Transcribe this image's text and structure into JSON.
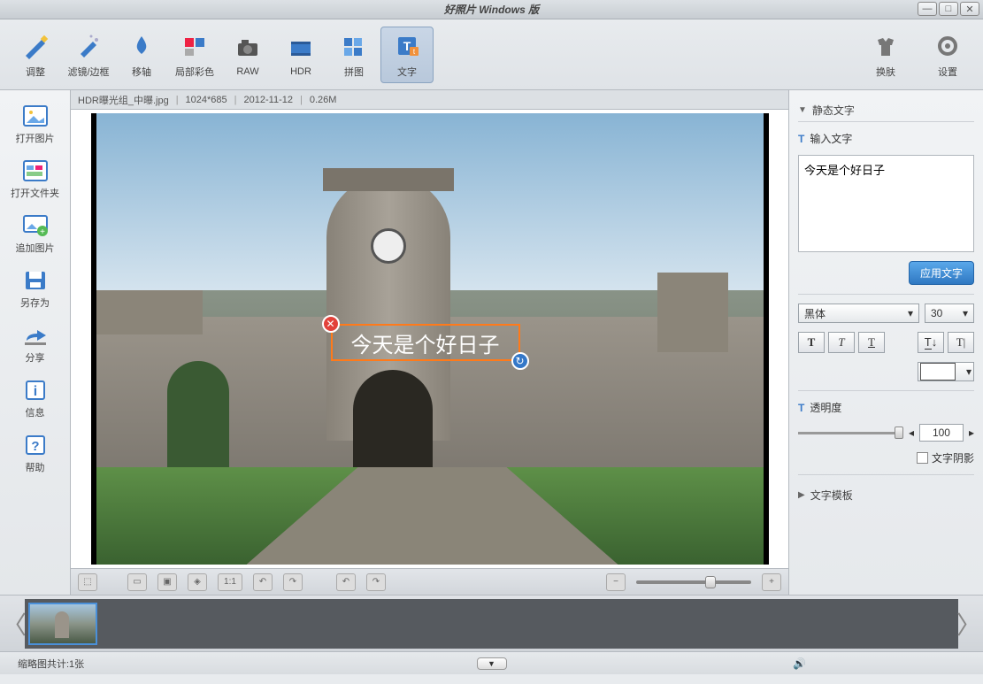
{
  "window": {
    "title": "好照片 Windows 版"
  },
  "toolbar": {
    "items": [
      {
        "label": "调整"
      },
      {
        "label": "滤镜/边框"
      },
      {
        "label": "移轴"
      },
      {
        "label": "局部彩色"
      },
      {
        "label": "RAW"
      },
      {
        "label": "HDR"
      },
      {
        "label": "拼图"
      },
      {
        "label": "文字"
      }
    ],
    "right": [
      {
        "label": "换肤"
      },
      {
        "label": "设置"
      }
    ]
  },
  "leftPanel": [
    {
      "label": "打开图片"
    },
    {
      "label": "打开文件夹"
    },
    {
      "label": "追加图片"
    },
    {
      "label": "另存为"
    },
    {
      "label": "分享"
    },
    {
      "label": "信息"
    },
    {
      "label": "帮助"
    }
  ],
  "infobar": {
    "filename": "HDR曝光组_中曝.jpg",
    "dimensions": "1024*685",
    "date": "2012-11-12",
    "size": "0.26M"
  },
  "canvas": {
    "overlayText": "今天是个好日子"
  },
  "canvasTools": {
    "ratioLabel": "1:1"
  },
  "rightPanel": {
    "staticTextHeader": "静态文字",
    "inputTextLabel": "输入文字",
    "textValue": "今天是个好日子",
    "applyBtn": "应用文字",
    "fontName": "黑体",
    "fontSize": "30",
    "opacityLabel": "透明度",
    "opacityValue": "100",
    "shadowLabel": "文字阴影",
    "templateHeader": "文字模板"
  },
  "status": {
    "thumbCount": "缩略图共计:1张"
  }
}
